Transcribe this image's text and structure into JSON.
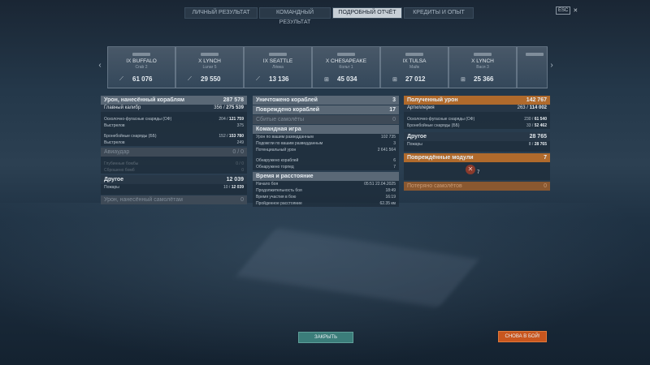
{
  "tabs": [
    {
      "label": "ЛИЧНЫЙ РЕЗУЛЬТАТ",
      "active": false
    },
    {
      "label": "КОМАНДНЫЙ РЕЗУЛЬТАТ",
      "active": false
    },
    {
      "label": "ПОДРОБНЫЙ ОТЧЁТ",
      "active": true
    },
    {
      "label": "КРЕДИТЫ И ОПЫТ",
      "active": false
    }
  ],
  "close_ctl": {
    "key": "ESC",
    "icon": "✕"
  },
  "ships": [
    {
      "tier": "IX",
      "name": "BUFFALO",
      "sub": "Crab 2",
      "damage": "61 076"
    },
    {
      "tier": "X",
      "name": "LYNCH",
      "sub": "Lunar 5",
      "damage": "29 550"
    },
    {
      "tier": "IX",
      "name": "SEATTLE",
      "sub": "Лёвка",
      "damage": "13 136"
    },
    {
      "tier": "X",
      "name": "CHESAPEAKE",
      "sub": "Кольт 1",
      "damage": "45 034"
    },
    {
      "tier": "IX",
      "name": "TULSA",
      "sub": "Майк",
      "damage": "27 012"
    },
    {
      "tier": "X",
      "name": "LYNCH",
      "sub": "Вася 3",
      "damage": "25 366"
    }
  ],
  "left": {
    "header": {
      "label": "Урон, нанесённый кораблям",
      "value": "287 578"
    },
    "main_caliber": {
      "label": "Главный калибр",
      "hits": "356",
      "value": "275 539"
    },
    "he": {
      "label": "Осколочно-фугасные снаряды (ОФ)",
      "hits": "204",
      "value": "121 759"
    },
    "he_shots": {
      "label": "Выстрелов",
      "value": "375"
    },
    "ap": {
      "label": "Бронебойные снаряды (ББ)",
      "hits": "152",
      "value": "153 780"
    },
    "ap_shots": {
      "label": "Выстрелов",
      "value": "249"
    },
    "aviation": {
      "label": "Авиаудар",
      "value": "0 / 0"
    },
    "depth": {
      "label": "Глубинные бомбы",
      "value": "0 / 0"
    },
    "depth_shots": {
      "label": "Сброшено бомб",
      "value": "0"
    },
    "other": {
      "label": "Другое",
      "value": "12 039"
    },
    "fires": {
      "label": "Пожары",
      "hits": "10",
      "value": "12 039"
    },
    "planes_dmg": {
      "label": "Урон, нанесённый самолётам",
      "value": "0"
    }
  },
  "middle": {
    "destroyed": {
      "label": "Уничтожено кораблей",
      "value": "3"
    },
    "damaged": {
      "label": "Повреждено кораблей",
      "value": "17"
    },
    "planes": {
      "label": "Сбитые самолёты",
      "value": "0"
    },
    "team": {
      "label": "Командная игра"
    },
    "spot_dmg": {
      "label": "Урон по вашим разведданным",
      "value": "102 735"
    },
    "spot_torp": {
      "label": "Подожгли по вашим разведданным",
      "value": "3"
    },
    "potential": {
      "label": "Потенциальный урон",
      "value": "2 641 564"
    },
    "spotted": {
      "label": "Обнаружено кораблей",
      "value": "6"
    },
    "torp": {
      "label": "Обнаружено торпед",
      "value": "7"
    },
    "time": {
      "label": "Время и расстояние"
    },
    "start": {
      "label": "Начало боя",
      "value": "05:51  22.04.2025"
    },
    "duration": {
      "label": "Продолжительность боя",
      "value": "18:49"
    },
    "participation": {
      "label": "Время участия в бою",
      "value": "16:19"
    },
    "distance": {
      "label": "Пройденное расстояние",
      "value": "62.35 км"
    }
  },
  "right": {
    "received": {
      "label": "Полученный урон",
      "value": "142 767"
    },
    "artillery": {
      "label": "Артиллерия",
      "hits": "263",
      "value": "114 002"
    },
    "he": {
      "label": "Осколочно-фугасные снаряды (ОФ)",
      "hits": "230",
      "value": "61 540"
    },
    "ap": {
      "label": "Бронебойные снаряды (ББ)",
      "hits": "33",
      "value": "52 462"
    },
    "other": {
      "label": "Другое",
      "value": "28 765"
    },
    "fires": {
      "label": "Пожары",
      "hits": "8",
      "value": "28 765"
    },
    "modules": {
      "label": "Повреждённые модули",
      "value": "7",
      "count": "7"
    },
    "planes_lost": {
      "label": "Потеряно самолётов",
      "value": "0"
    }
  },
  "buttons": {
    "close": "ЗАКРЫТЬ",
    "again": "СНОВА В БОЙ!"
  }
}
